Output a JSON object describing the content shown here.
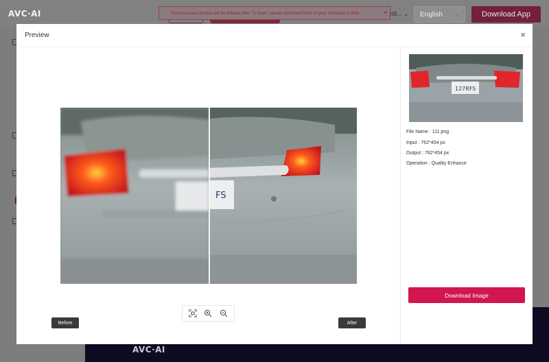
{
  "app": {
    "logo": "AVC·AI",
    "toast": "The processed photos will be deleted after 72 hours, please download them to your computer in time.",
    "toast_close": "×",
    "account_truncated": "n9...",
    "language": "English",
    "download_app_label": "Download App",
    "footer_logo": "AVC·AI"
  },
  "modal": {
    "title": "Preview",
    "close": "×",
    "before_label": "Before",
    "after_label": "After",
    "comparison_split": 0.5
  },
  "info": {
    "file_name": "File Name : 111.png",
    "input": "Input : 762*454 px",
    "output": "Output : 762*454 px",
    "operation": "Operation : Quality Enhance"
  },
  "actions": {
    "download_image_label": "Download Image"
  },
  "icons": {
    "fit": "fit-screen-icon",
    "zoom_in": "zoom-in-icon",
    "zoom_out": "zoom-out-icon",
    "close": "close-icon"
  },
  "colors": {
    "accent": "#d2164f",
    "tag_bg": "#3a3a3a",
    "footer": "#0d0b22"
  }
}
